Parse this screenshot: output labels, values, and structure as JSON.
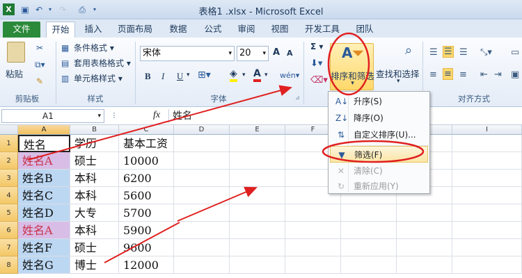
{
  "window": {
    "title": "表格1 .xlsx - Microsoft Excel"
  },
  "tabs": [
    "文件",
    "开始",
    "插入",
    "页面布局",
    "数据",
    "公式",
    "审阅",
    "视图",
    "开发工具",
    "团队"
  ],
  "ribbon": {
    "clipboard": {
      "paste": "粘贴",
      "group": "剪贴板"
    },
    "styles": {
      "conditional": "条件格式",
      "table": "套用表格格式",
      "cell": "单元格样式",
      "group": "样式"
    },
    "font": {
      "name": "宋体",
      "size": "20",
      "bold": "B",
      "italic": "I",
      "underline": "U",
      "group": "字体",
      "wen": "wén",
      "grow": "A",
      "shrink": "A"
    },
    "editing": {
      "sigma": "Σ",
      "sort_filter": "排序和筛选",
      "find_select": "查找和选择"
    },
    "alignment": {
      "group": "对齐方式"
    }
  },
  "formula_bar": {
    "name_box": "A1",
    "fx": "fx",
    "value": "姓名"
  },
  "columns": [
    "A",
    "B",
    "C",
    "D",
    "E",
    "F",
    "G",
    "H",
    "I"
  ],
  "rows": [
    "1",
    "2",
    "3",
    "4",
    "5",
    "6",
    "7",
    "8"
  ],
  "cells": [
    [
      "姓名",
      "学历",
      "基本工资"
    ],
    [
      "姓名A",
      "硕士",
      "10000"
    ],
    [
      "姓名B",
      "本科",
      "6200"
    ],
    [
      "姓名C",
      "本科",
      "5600"
    ],
    [
      "姓名D",
      "大专",
      "5700"
    ],
    [
      "姓名A",
      "本科",
      "5900"
    ],
    [
      "姓名F",
      "硕士",
      "9600"
    ],
    [
      "姓名G",
      "博士",
      "12000"
    ]
  ],
  "sort_menu": [
    {
      "label": "升序(S)",
      "enabled": true,
      "icon": "sort-ascending-icon",
      "glyph": "A↓"
    },
    {
      "label": "降序(O)",
      "enabled": true,
      "icon": "sort-descending-icon",
      "glyph": "Z↓"
    },
    {
      "label": "自定义排序(U)...",
      "enabled": true,
      "icon": "custom-sort-icon",
      "glyph": "⇅"
    },
    {
      "label": "筛选(F)",
      "enabled": true,
      "highlighted": true,
      "icon": "filter-icon",
      "glyph": "▼"
    },
    {
      "label": "清除(C)",
      "enabled": false,
      "icon": "clear-filter-icon",
      "glyph": "✕"
    },
    {
      "label": "重新应用(Y)",
      "enabled": false,
      "icon": "reapply-icon",
      "glyph": "↻"
    }
  ],
  "colors": {
    "accent_red": "#e02020",
    "file_tab": "#2a8a3a",
    "dup_text": "#c8324a",
    "dup_fill": "#d8bde6",
    "sel_fill": "#bcd7f2"
  }
}
